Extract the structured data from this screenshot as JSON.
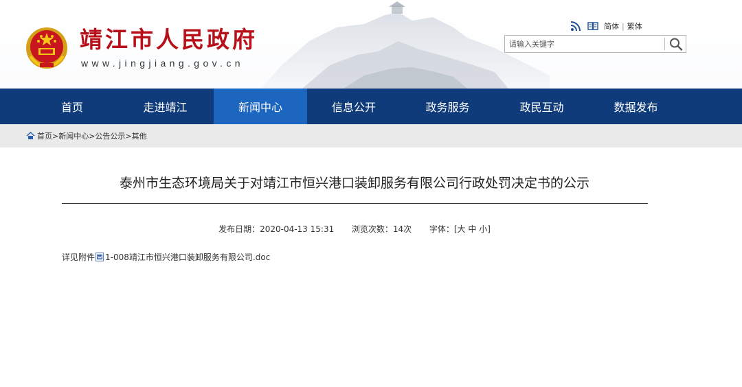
{
  "header": {
    "site_title": "靖江市人民政府",
    "site_domain": "www.jingjiang.gov.cn",
    "toolbar": {
      "rss_icon": "rss-icon",
      "read_icon": "book-icon",
      "simplified": "简体",
      "divider": "|",
      "traditional": "繁体"
    },
    "search": {
      "placeholder": "请输入关键字",
      "button_icon": "search-icon"
    }
  },
  "nav": {
    "items": [
      {
        "label": "首页",
        "active": false
      },
      {
        "label": "走进靖江",
        "active": false
      },
      {
        "label": "新闻中心",
        "active": true
      },
      {
        "label": "信息公开",
        "active": false
      },
      {
        "label": "政务服务",
        "active": false
      },
      {
        "label": "政民互动",
        "active": false
      },
      {
        "label": "数据发布",
        "active": false
      }
    ]
  },
  "breadcrumb": {
    "icon": "home-icon",
    "items": [
      "首页",
      "新闻中心",
      "公告公示",
      "其他"
    ],
    "separator": ">"
  },
  "article": {
    "title": "泰州市生态环境局关于对靖江市恒兴港口装卸服务有限公司行政处罚决定书的公示",
    "meta": {
      "date_label": "发布日期：",
      "date_value": "2020-04-13 15:31",
      "views_label": "浏览次数：",
      "views_value": "14次",
      "font_label": "字体：",
      "font_open": "[",
      "font_large": "大",
      "font_medium": "中",
      "font_small": "小",
      "font_close": "]"
    },
    "body_prefix": "详见附件",
    "attachment_icon": "word-doc-icon",
    "attachment_name": "1-008靖江市恒兴港口装卸服务有限公司.doc"
  },
  "colors": {
    "nav_bg": "#0f3b7a",
    "nav_active": "#1d66c0",
    "title_red": "#b8101a",
    "crumb_bg": "#eaeaea"
  }
}
